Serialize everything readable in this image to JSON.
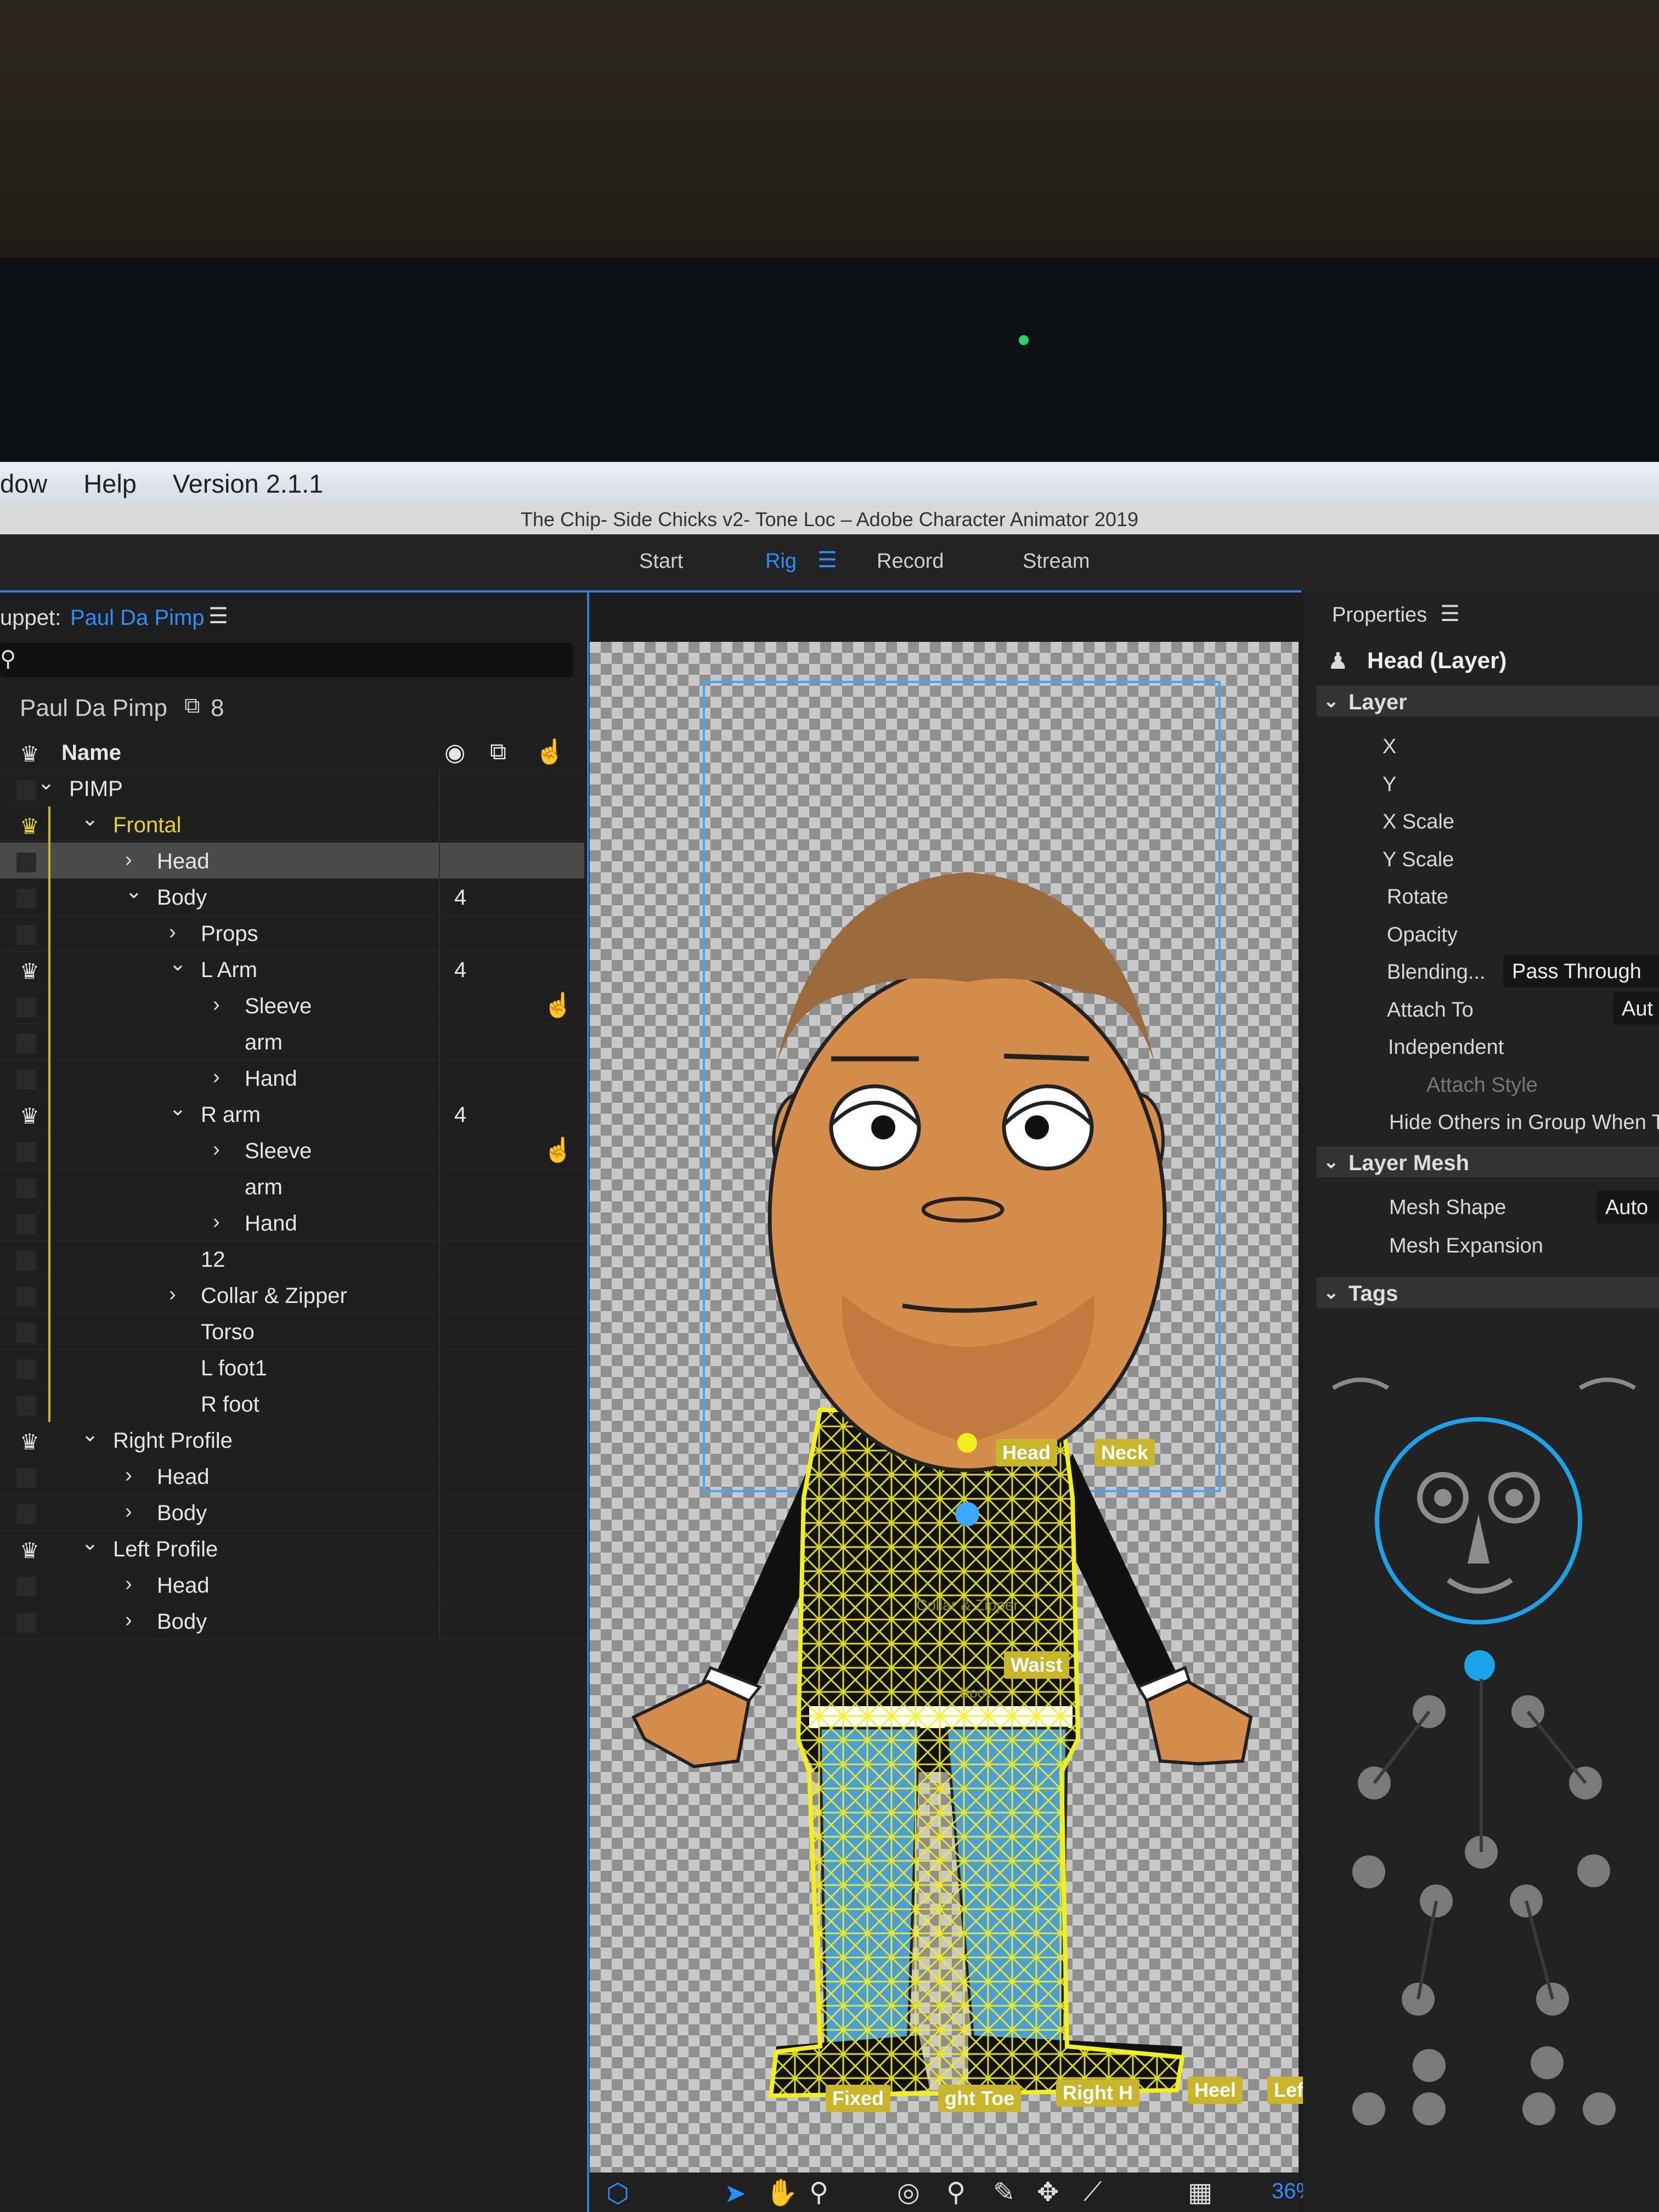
{
  "menubar": {
    "items": [
      "dow",
      "Help",
      "Version 2.1.1"
    ]
  },
  "window": {
    "title": "The Chip- Side Chicks v2- Tone Loc – Adobe Character Animator 2019"
  },
  "workspace": {
    "tabs": [
      "Start",
      "Rig",
      "Record",
      "Stream"
    ]
  },
  "puppet_panel": {
    "header_prefix": "uppet:",
    "puppet_name": "Paul Da Pimp",
    "root_name": "Paul Da Pimp",
    "root_count": "8",
    "column_name": "Name",
    "rows": [
      {
        "label": "PIMP",
        "count": ""
      },
      {
        "label": "Frontal",
        "count": ""
      },
      {
        "label": "Head",
        "count": ""
      },
      {
        "label": "Body",
        "count": "4"
      },
      {
        "label": "Props",
        "count": ""
      },
      {
        "label": "L Arm",
        "count": "4"
      },
      {
        "label": "Sleeve",
        "count": ""
      },
      {
        "label": "arm",
        "count": ""
      },
      {
        "label": "Hand",
        "count": ""
      },
      {
        "label": "R arm",
        "count": "4"
      },
      {
        "label": "Sleeve",
        "count": ""
      },
      {
        "label": "arm",
        "count": ""
      },
      {
        "label": "Hand",
        "count": ""
      },
      {
        "label": "12",
        "count": ""
      },
      {
        "label": "Collar & Zipper",
        "count": ""
      },
      {
        "label": "Torso",
        "count": ""
      },
      {
        "label": "L foot1",
        "count": ""
      },
      {
        "label": "R foot",
        "count": ""
      },
      {
        "label": "Right Profile",
        "count": ""
      },
      {
        "label": "Head",
        "count": ""
      },
      {
        "label": "Body",
        "count": ""
      },
      {
        "label": "Left Profile",
        "count": ""
      },
      {
        "label": "Head",
        "count": ""
      },
      {
        "label": "Body",
        "count": ""
      }
    ]
  },
  "stage": {
    "tags": [
      "Head",
      "Neck",
      "Waist",
      "Fixed",
      "ght Toe",
      "Right H",
      "Heel",
      "Left"
    ],
    "mesh_labels": [
      "Collar & Zipper",
      "Body"
    ],
    "zoom": "36%"
  },
  "properties": {
    "panel_title": "Properties",
    "selection": "Head (Layer)",
    "layer_section": "Layer",
    "layer_fields": [
      "X",
      "Y",
      "X Scale",
      "Y Scale",
      "Rotate",
      "Opacity",
      "Blending...",
      "Attach To",
      "Independent",
      "Attach Style",
      "Hide Others in Group When T"
    ],
    "blending_value": "Pass Through",
    "attach_value": "Aut",
    "mesh_section": "Layer Mesh",
    "mesh_fields": [
      "Mesh Shape",
      "Mesh Expansion"
    ],
    "mesh_shape_value": "Auto",
    "tags_section": "Tags"
  },
  "colors": {
    "accent": "#2a8fff",
    "mesh": "#f2ef1e",
    "skin": "#d68c4a"
  }
}
